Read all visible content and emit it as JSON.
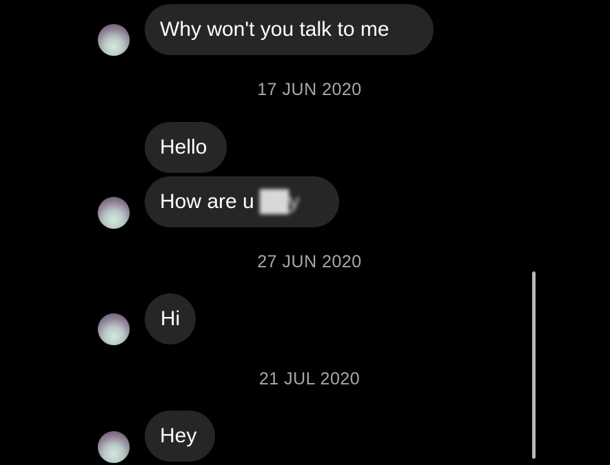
{
  "thread": {
    "messages": [
      {
        "text": "Why won't you talk to me"
      },
      {
        "text": "Hello"
      },
      {
        "text_visible": "How are u",
        "text_obscured": "y"
      },
      {
        "text": "Hi"
      },
      {
        "text": "Hey"
      }
    ],
    "dates": [
      "17 JUN 2020",
      "27 JUN 2020",
      "21 JUL 2020"
    ]
  },
  "colors": {
    "background": "#000000",
    "bubble": "#262626",
    "date_text": "#a8a8a8",
    "scrollbar": "#b9b9b9"
  }
}
